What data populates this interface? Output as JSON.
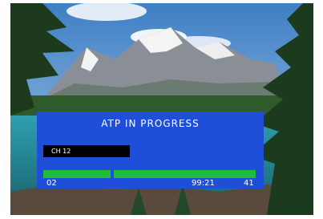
{
  "osd": {
    "title": "ATP IN PROGRESS",
    "channel_label": "CH 12",
    "progress_left_value": "02",
    "time_value": "99:21",
    "progress_right_value": "41",
    "accent_color": "#1f4fd8",
    "bar_color": "#1fbd3b"
  }
}
